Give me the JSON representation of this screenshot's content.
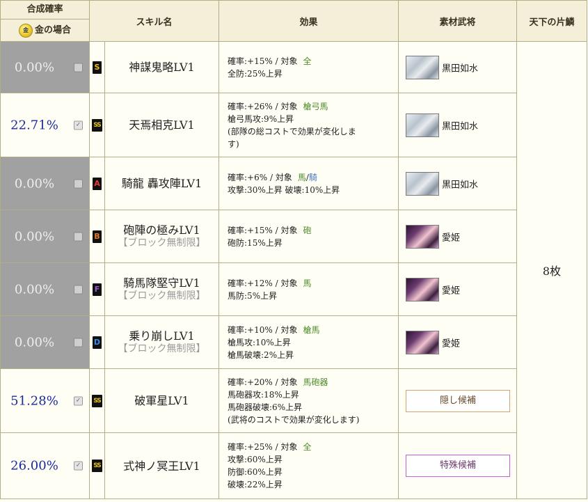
{
  "header": {
    "prob_top": "合成確率",
    "prob_bottom": "金の場合",
    "coin_glyph": "金",
    "skill_name": "スキル名",
    "effect": "効果",
    "material": "素材武将",
    "scale": "天下の片鱗"
  },
  "colors": {
    "rank_S": "#e8c020",
    "rank_SS": "#e8c020",
    "rank_A": "#e83838",
    "rank_B": "#e87828",
    "rank_F": "#9a5ad0",
    "rank_D": "#3a8ae8",
    "target": "#4d8a2a",
    "target_blue": "#4a7cc8"
  },
  "scale_value": "8枚",
  "rows": [
    {
      "prob": "0.00%",
      "state": "off",
      "checked": false,
      "rank": "S",
      "name": "神謀鬼略LV1",
      "sub": "",
      "effect": {
        "line1_pre": "確率:+15% / 対象",
        "target": "全",
        "target2": "",
        "lines": [
          "全防:25%上昇"
        ]
      },
      "material": {
        "type": "general",
        "name": "黒田如水",
        "portrait": "kuroda"
      }
    },
    {
      "prob": "22.71%",
      "state": "on",
      "checked": true,
      "rank": "SS",
      "name": "天焉相克LV1",
      "sub": "",
      "effect": {
        "line1_pre": "確率:+26% / 対象",
        "target": "槍弓馬",
        "target2": "",
        "lines": [
          "槍弓馬攻:9%上昇",
          "(部隊の総コストで効果が変化しま",
          "す)"
        ]
      },
      "material": {
        "type": "general",
        "name": "黒田如水",
        "portrait": "kuroda"
      }
    },
    {
      "prob": "0.00%",
      "state": "off",
      "checked": false,
      "rank": "A",
      "name": "騎龍 轟攻陣LV1",
      "sub": "",
      "effect": {
        "line1_pre": "確率:+6% / 対象",
        "target": "馬",
        "target2": "騎",
        "lines": [
          "攻撃:30%上昇 破壊:10%上昇"
        ]
      },
      "material": {
        "type": "general",
        "name": "黒田如水",
        "portrait": "kuroda"
      }
    },
    {
      "prob": "0.00%",
      "state": "off",
      "checked": false,
      "rank": "B",
      "name": "砲陣の極みLV1",
      "sub": "【ブロック無制限】",
      "effect": {
        "line1_pre": "確率:+15% / 対象",
        "target": "砲",
        "target2": "",
        "lines": [
          "砲防:15%上昇"
        ]
      },
      "material": {
        "type": "general",
        "name": "愛姫",
        "portrait": "mego"
      }
    },
    {
      "prob": "0.00%",
      "state": "off",
      "checked": false,
      "rank": "F",
      "name": "騎馬隊堅守LV1",
      "sub": "【ブロック無制限】",
      "effect": {
        "line1_pre": "確率:+12% / 対象",
        "target": "馬",
        "target2": "",
        "lines": [
          "馬防:5%上昇"
        ]
      },
      "material": {
        "type": "general",
        "name": "愛姫",
        "portrait": "mego"
      }
    },
    {
      "prob": "0.00%",
      "state": "off",
      "checked": false,
      "rank": "D",
      "name": "乗り崩しLV1",
      "sub": "【ブロック無制限】",
      "effect": {
        "line1_pre": "確率:+10% / 対象",
        "target": "槍馬",
        "target2": "",
        "lines": [
          "槍馬攻:10%上昇",
          "槍馬破壊:2%上昇"
        ]
      },
      "material": {
        "type": "general",
        "name": "愛姫",
        "portrait": "mego"
      }
    },
    {
      "prob": "51.28%",
      "state": "on",
      "checked": true,
      "rank": "SS",
      "name": "破軍星LV1",
      "sub": "",
      "effect": {
        "line1_pre": "確率:+20% / 対象",
        "target": "馬砲器",
        "target2": "",
        "lines": [
          "馬砲器攻:18%上昇",
          "馬砲器破壊:6%上昇",
          "(武将のコストで効果が変化します)"
        ]
      },
      "material": {
        "type": "button",
        "label": "隠し候補",
        "style": "hidden"
      }
    },
    {
      "prob": "26.00%",
      "state": "on",
      "checked": true,
      "rank": "SS",
      "name": "式神ノ冥王LV1",
      "sub": "",
      "effect": {
        "line1_pre": "確率:+25% / 対象",
        "target": "全",
        "target2": "",
        "lines": [
          "攻撃:60%上昇",
          "防御:60%上昇",
          "破壊:22%上昇"
        ]
      },
      "material": {
        "type": "button",
        "label": "特殊候補",
        "style": "special"
      }
    }
  ]
}
